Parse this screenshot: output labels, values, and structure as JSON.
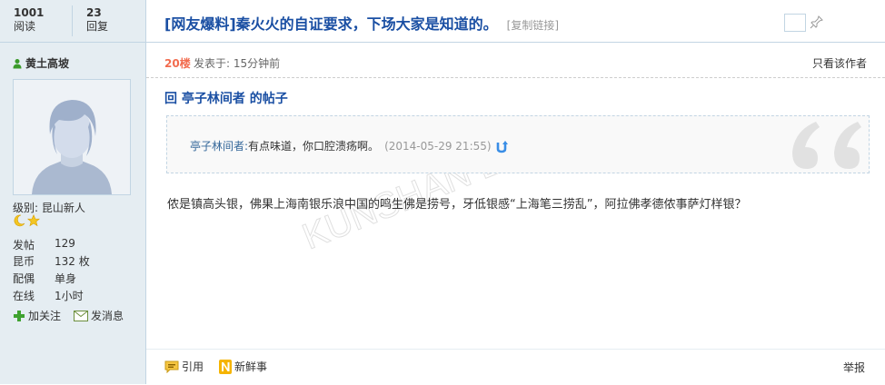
{
  "stats": {
    "views_num": "1001",
    "views_label": "阅读",
    "replies_num": "23",
    "replies_label": "回复"
  },
  "thread": {
    "title": "[网友爆料]秦火火的自证要求，下场大家是知道的。",
    "copy_link": "[复制链接]"
  },
  "user": {
    "name": "黄土高坡",
    "level_text": "级别: 昆山新人",
    "info": [
      {
        "key": "发帖",
        "value": "129"
      },
      {
        "key": "昆币",
        "value": "132 枚"
      },
      {
        "key": "配偶",
        "value": "单身"
      },
      {
        "key": "在线",
        "value": "1小时"
      }
    ],
    "follow_label": "加关注",
    "message_label": "发消息"
  },
  "post": {
    "floor": "20楼",
    "time": "发表于: 15分钟前",
    "only_author": "只看该作者",
    "reply_heading": "回 亭子林间者 的帖子",
    "quote_author": "亭子林间者:",
    "quote_content": "有点味道，你口腔溃疡啊。",
    "quote_date": "(2014-05-29 21:55)",
    "body": "侬是镇高头银，佛果上海南银乐浪中国的鸣生佛是捞号，牙低银感“上海笔三捞乱”，阿拉佛孝德侬事萨灯样银？",
    "watermark": "KUNSHAN BBS"
  },
  "footer": {
    "quote_label": "引用",
    "fresh_label": "新鲜事",
    "report_label": "举报"
  },
  "colors": {
    "title_blue": "#1a4fa3",
    "floor_orange": "#f26c4f",
    "sidebar_bg": "#e5edf2",
    "border_blue": "#c2d5e3"
  }
}
